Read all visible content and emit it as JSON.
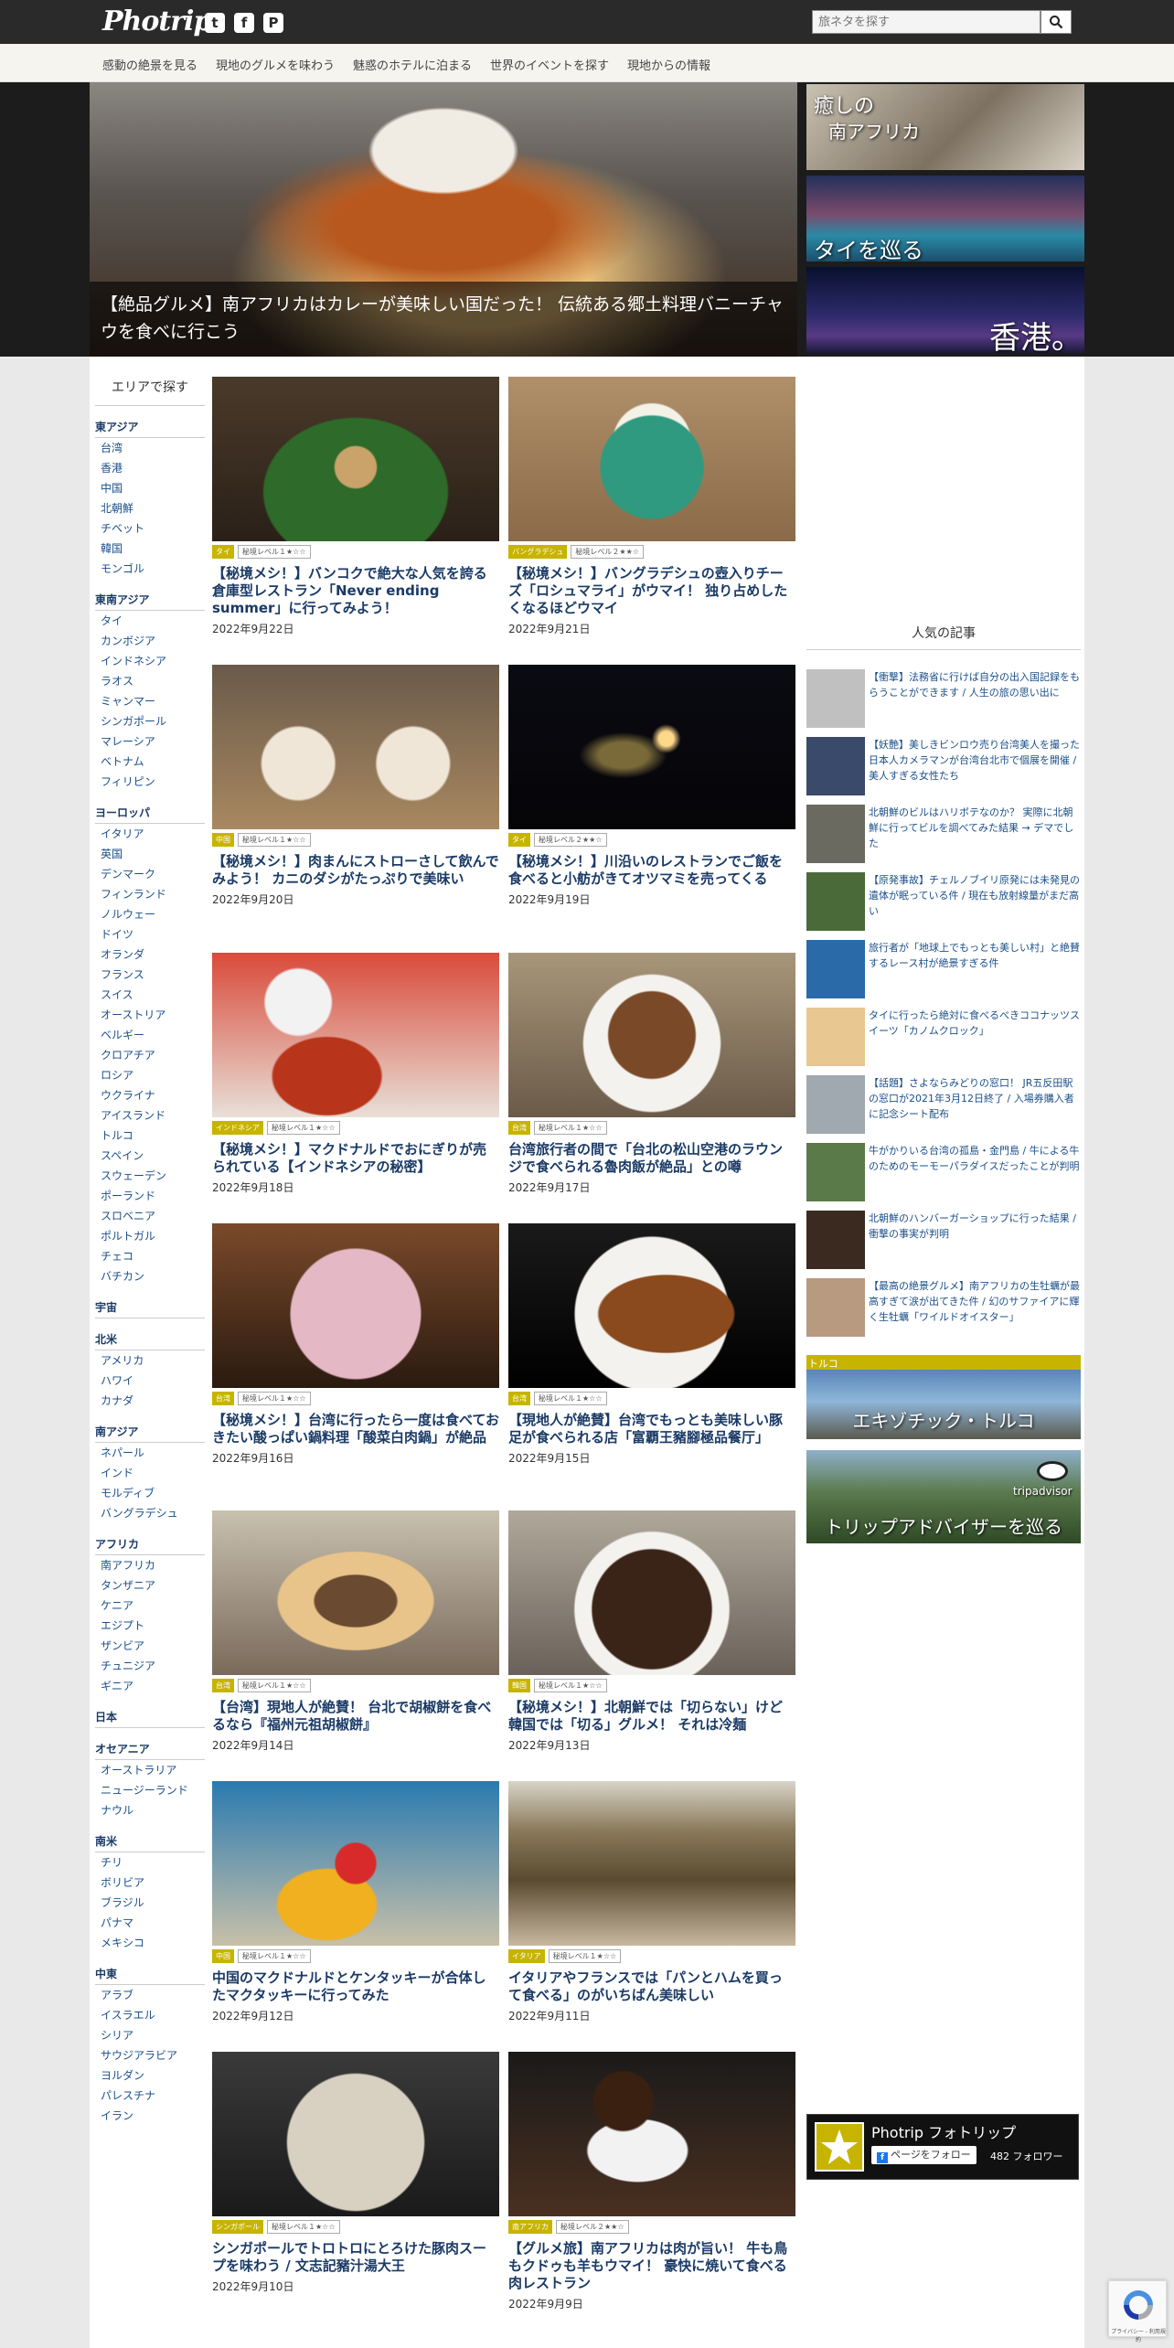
{
  "header": {
    "logo": "Photrip",
    "social": [
      "twitter-icon",
      "facebook-icon",
      "pinterest-icon"
    ],
    "search_placeholder": "旅ネタを探す"
  },
  "nav": {
    "items": [
      "感動の絶景を見る",
      "現地のグルメを味わう",
      "魅惑のホテルに泊まる",
      "世界のイベントを探す",
      "現地からの情報"
    ]
  },
  "hero": {
    "caption": "【絶品グルメ】南アフリカはカレーが美味しい国だった！ 伝統ある郷土料理バニーチャウを食べに行こう",
    "side": [
      {
        "line1": "癒しの",
        "line2": "南アフリカ"
      },
      {
        "line1": "タイを巡る"
      },
      {
        "line1": "香港。"
      }
    ]
  },
  "sidebar": {
    "title": "エリアで探す",
    "regions": [
      {
        "name": "東アジア",
        "items": [
          "台湾",
          "香港",
          "中国",
          "北朝鮮",
          "チベット",
          "韓国",
          "モンゴル"
        ]
      },
      {
        "name": "東南アジア",
        "items": [
          "タイ",
          "カンボジア",
          "インドネシア",
          "ラオス",
          "ミャンマー",
          "シンガポール",
          "マレーシア",
          "ベトナム",
          "フィリピン"
        ]
      },
      {
        "name": "ヨーロッパ",
        "items": [
          "イタリア",
          "英国",
          "デンマーク",
          "フィンランド",
          "ノルウェー",
          "ドイツ",
          "オランダ",
          "フランス",
          "スイス",
          "オーストリア",
          "ベルギー",
          "クロアチア",
          "ロシア",
          "ウクライナ",
          "アイスランド",
          "トルコ",
          "スペイン",
          "スウェーデン",
          "ポーランド",
          "スロベニア",
          "ポルトガル",
          "チェコ",
          "バチカン"
        ]
      },
      {
        "name": "宇宙",
        "items": []
      },
      {
        "name": "北米",
        "items": [
          "アメリカ",
          "ハワイ",
          "カナダ"
        ]
      },
      {
        "name": "南アジア",
        "items": [
          "ネパール",
          "インド",
          "モルディブ",
          "バングラデシュ"
        ]
      },
      {
        "name": "アフリカ",
        "items": [
          "南アフリカ",
          "タンザニア",
          "ケニア",
          "エジプト",
          "ザンビア",
          "チュニジア",
          "ギニア"
        ]
      },
      {
        "name": "日本",
        "items": []
      },
      {
        "name": "オセアニア",
        "items": [
          "オーストラリア",
          "ニュージーランド",
          "ナウル"
        ]
      },
      {
        "name": "南米",
        "items": [
          "チリ",
          "ボリビア",
          "ブラジル",
          "パナマ",
          "メキシコ"
        ]
      },
      {
        "name": "中東",
        "items": [
          "アラブ",
          "イスラエル",
          "シリア",
          "サウジアラビア",
          "ヨルダン",
          "パレスチナ",
          "イラン"
        ]
      }
    ]
  },
  "articles": [
    {
      "country": "タイ",
      "level": "秘境レベル１★☆☆",
      "title": "【秘境メシ！】バンコクで絶大な人気を誇る倉庫型レストラン「Never ending summer」に行ってみよう！",
      "date": "2022年9月22日"
    },
    {
      "country": "バングラデシュ",
      "level": "秘境レベル２★★☆",
      "title": "【秘境メシ！】バングラデシュの壺入りチーズ「ロシュマライ」がウマイ！ 独り占めしたくなるほどウマイ",
      "date": "2022年9月21日"
    },
    {
      "country": "中国",
      "level": "秘境レベル１★☆☆",
      "title": "【秘境メシ！】肉まんにストローさして飲んでみよう！ カニのダシがたっぷりで美味い",
      "date": "2022年9月20日"
    },
    {
      "country": "タイ",
      "level": "秘境レベル２★★☆",
      "title": "【秘境メシ！】川沿いのレストランでご飯を食べると小舫がきてオツマミを売ってくる",
      "date": "2022年9月19日"
    },
    {
      "country": "インドネシア",
      "level": "秘境レベル１★☆☆",
      "title": "【秘境メシ！】マクドナルドでおにぎりが売られている【インドネシアの秘密】",
      "date": "2022年9月18日"
    },
    {
      "country": "台湾",
      "level": "秘境レベル１★☆☆",
      "title": "台湾旅行者の間で「台北の松山空港のラウンジで食べられる魯肉飯が絶品」との噂",
      "date": "2022年9月17日"
    },
    {
      "country": "台湾",
      "level": "秘境レベル１★☆☆",
      "title": "【秘境メシ！】台湾に行ったら一度は食べておきたい酸っぱい鍋料理「酸菜白肉鍋」が絶品",
      "date": "2022年9月16日"
    },
    {
      "country": "台湾",
      "level": "秘境レベル１★☆☆",
      "title": "【現地人が絶賛】台湾でもっとも美味しい豚足が食べられる店「富覇王豬腳極品餐厅」",
      "date": "2022年9月15日"
    },
    {
      "country": "台湾",
      "level": "秘境レベル１★☆☆",
      "title": "【台湾】現地人が絶賛！ 台北で胡椒餅を食べるなら『福州元祖胡椒餅』",
      "date": "2022年9月14日"
    },
    {
      "country": "韓国",
      "level": "秘境レベル１★☆☆",
      "title": "【秘境メシ！】北朝鮮では「切らない」けど韓国では「切る」グルメ！ それは冷麺",
      "date": "2022年9月13日"
    },
    {
      "country": "中国",
      "level": "秘境レベル１★☆☆",
      "title": "中国のマクドナルドとケンタッキーが合体したマクタッキーに行ってみた",
      "date": "2022年9月12日"
    },
    {
      "country": "イタリア",
      "level": "秘境レベル１★☆☆",
      "title": "イタリアやフランスでは「パンとハムを買って食べる」のがいちばん美味しい",
      "date": "2022年9月11日"
    },
    {
      "country": "シンガポール",
      "level": "秘境レベル１★☆☆",
      "title": "シンガポールでトロトロにとろけた豚肉スープを味わう / 文志記豬汁湯大王",
      "date": "2022年9月10日"
    },
    {
      "country": "南アフリカ",
      "level": "秘境レベル２★★☆",
      "title": "【グルメ旅】南アフリカは肉が旨い！ 牛も鳥もクドゥも羊もウマイ！ 豪快に焼いて食べる肉レストラン",
      "date": "2022年9月9日"
    }
  ],
  "popular": {
    "title": "人気の記事",
    "items": [
      "【衝撃】法務省に行けば自分の出入国記録をもらうことができます / 人生の旅の思い出に",
      "【妖艶】美しきビンロウ売り台湾美人を撮った日本人カメラマンが台湾台北市で個展を開催 / 美人すぎる女性たち",
      "北朝鮮のビルはハリボテなのか？ 実際に北朝鮮に行ってビルを調べてみた結果 → デマでした",
      "【原発事故】チェルノブイリ原発には未発見の遺体が眠っている件 / 現在も放射線量がまだ高い",
      "旅行者が「地球上でもっとも美しい村」と絶賛するレース村が絶景すぎる件",
      "タイに行ったら絶対に食べるべきココナッツスイーツ「カノムクロック」",
      "【話題】さよならみどりの窓口！ JR五反田駅の窓口が2021年3月12日終了 / 入場券購入者に記念シート配布",
      "牛がかりいる台湾の孤島・金門島 / 牛による牛のためのモーモーパラダイスだったことが判明",
      "北朝鮮のハンバーガーショップに行った結果 / 衝撃の事実が判明",
      "【最高の絶景グルメ】南アフリカの生牡蠣が最高すぎて涙が出てきた件 / 幻のサファイアに輝く生牡蠣「ワイルドオイスター」"
    ]
  },
  "banners": {
    "turkey_tag": "トルコ",
    "turkey_label": "エキゾチック・トルコ",
    "tripadvisor_logo": "tripadvisor",
    "tripadvisor_label": "トリップアドバイザーを巡る"
  },
  "facebook": {
    "name": "Photrip フォトリップ",
    "follow": "ページをフォロー",
    "count": "482 フォロワー"
  },
  "recaptcha": {
    "text": "プライバシー - 利用規約"
  }
}
